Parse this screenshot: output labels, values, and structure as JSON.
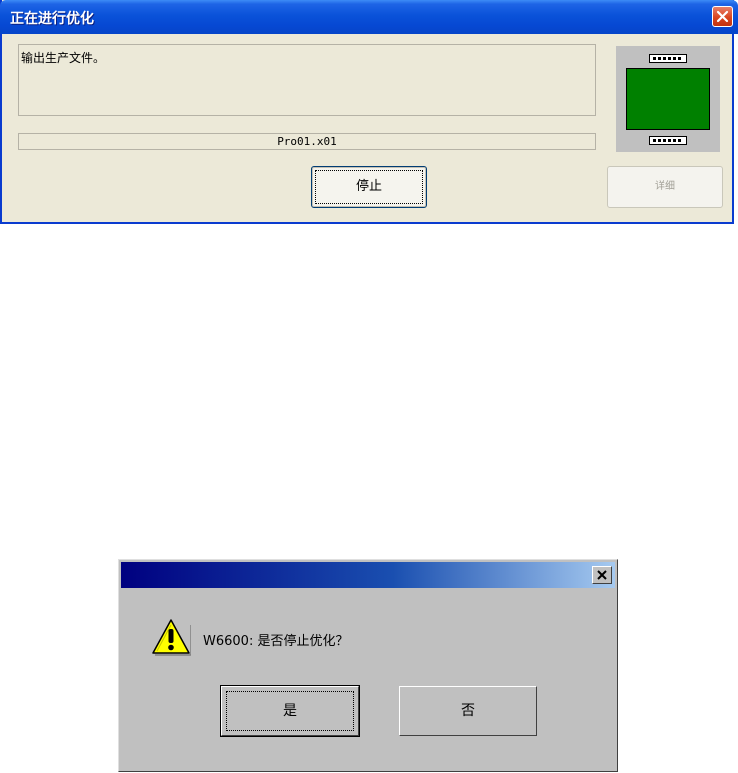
{
  "progress_window": {
    "title": "正在进行优化",
    "message": "输出生产文件。",
    "file_name": "Pro01.x01",
    "stop_label": "停止",
    "detail_label": "详细"
  },
  "confirm_dialog": {
    "message": "W6600: 是否停止优化？",
    "yes_label": "是",
    "no_label": "否"
  },
  "colors": {
    "xp_title_blue": "#0648d3",
    "board_screen": "#008000",
    "classic_title_start": "#000080",
    "warning_yellow": "#ffff00"
  },
  "icons": {
    "xp_close": "close-icon",
    "classic_close": "close-icon",
    "warning": "warning-icon",
    "board": "circuit-board-icon"
  }
}
